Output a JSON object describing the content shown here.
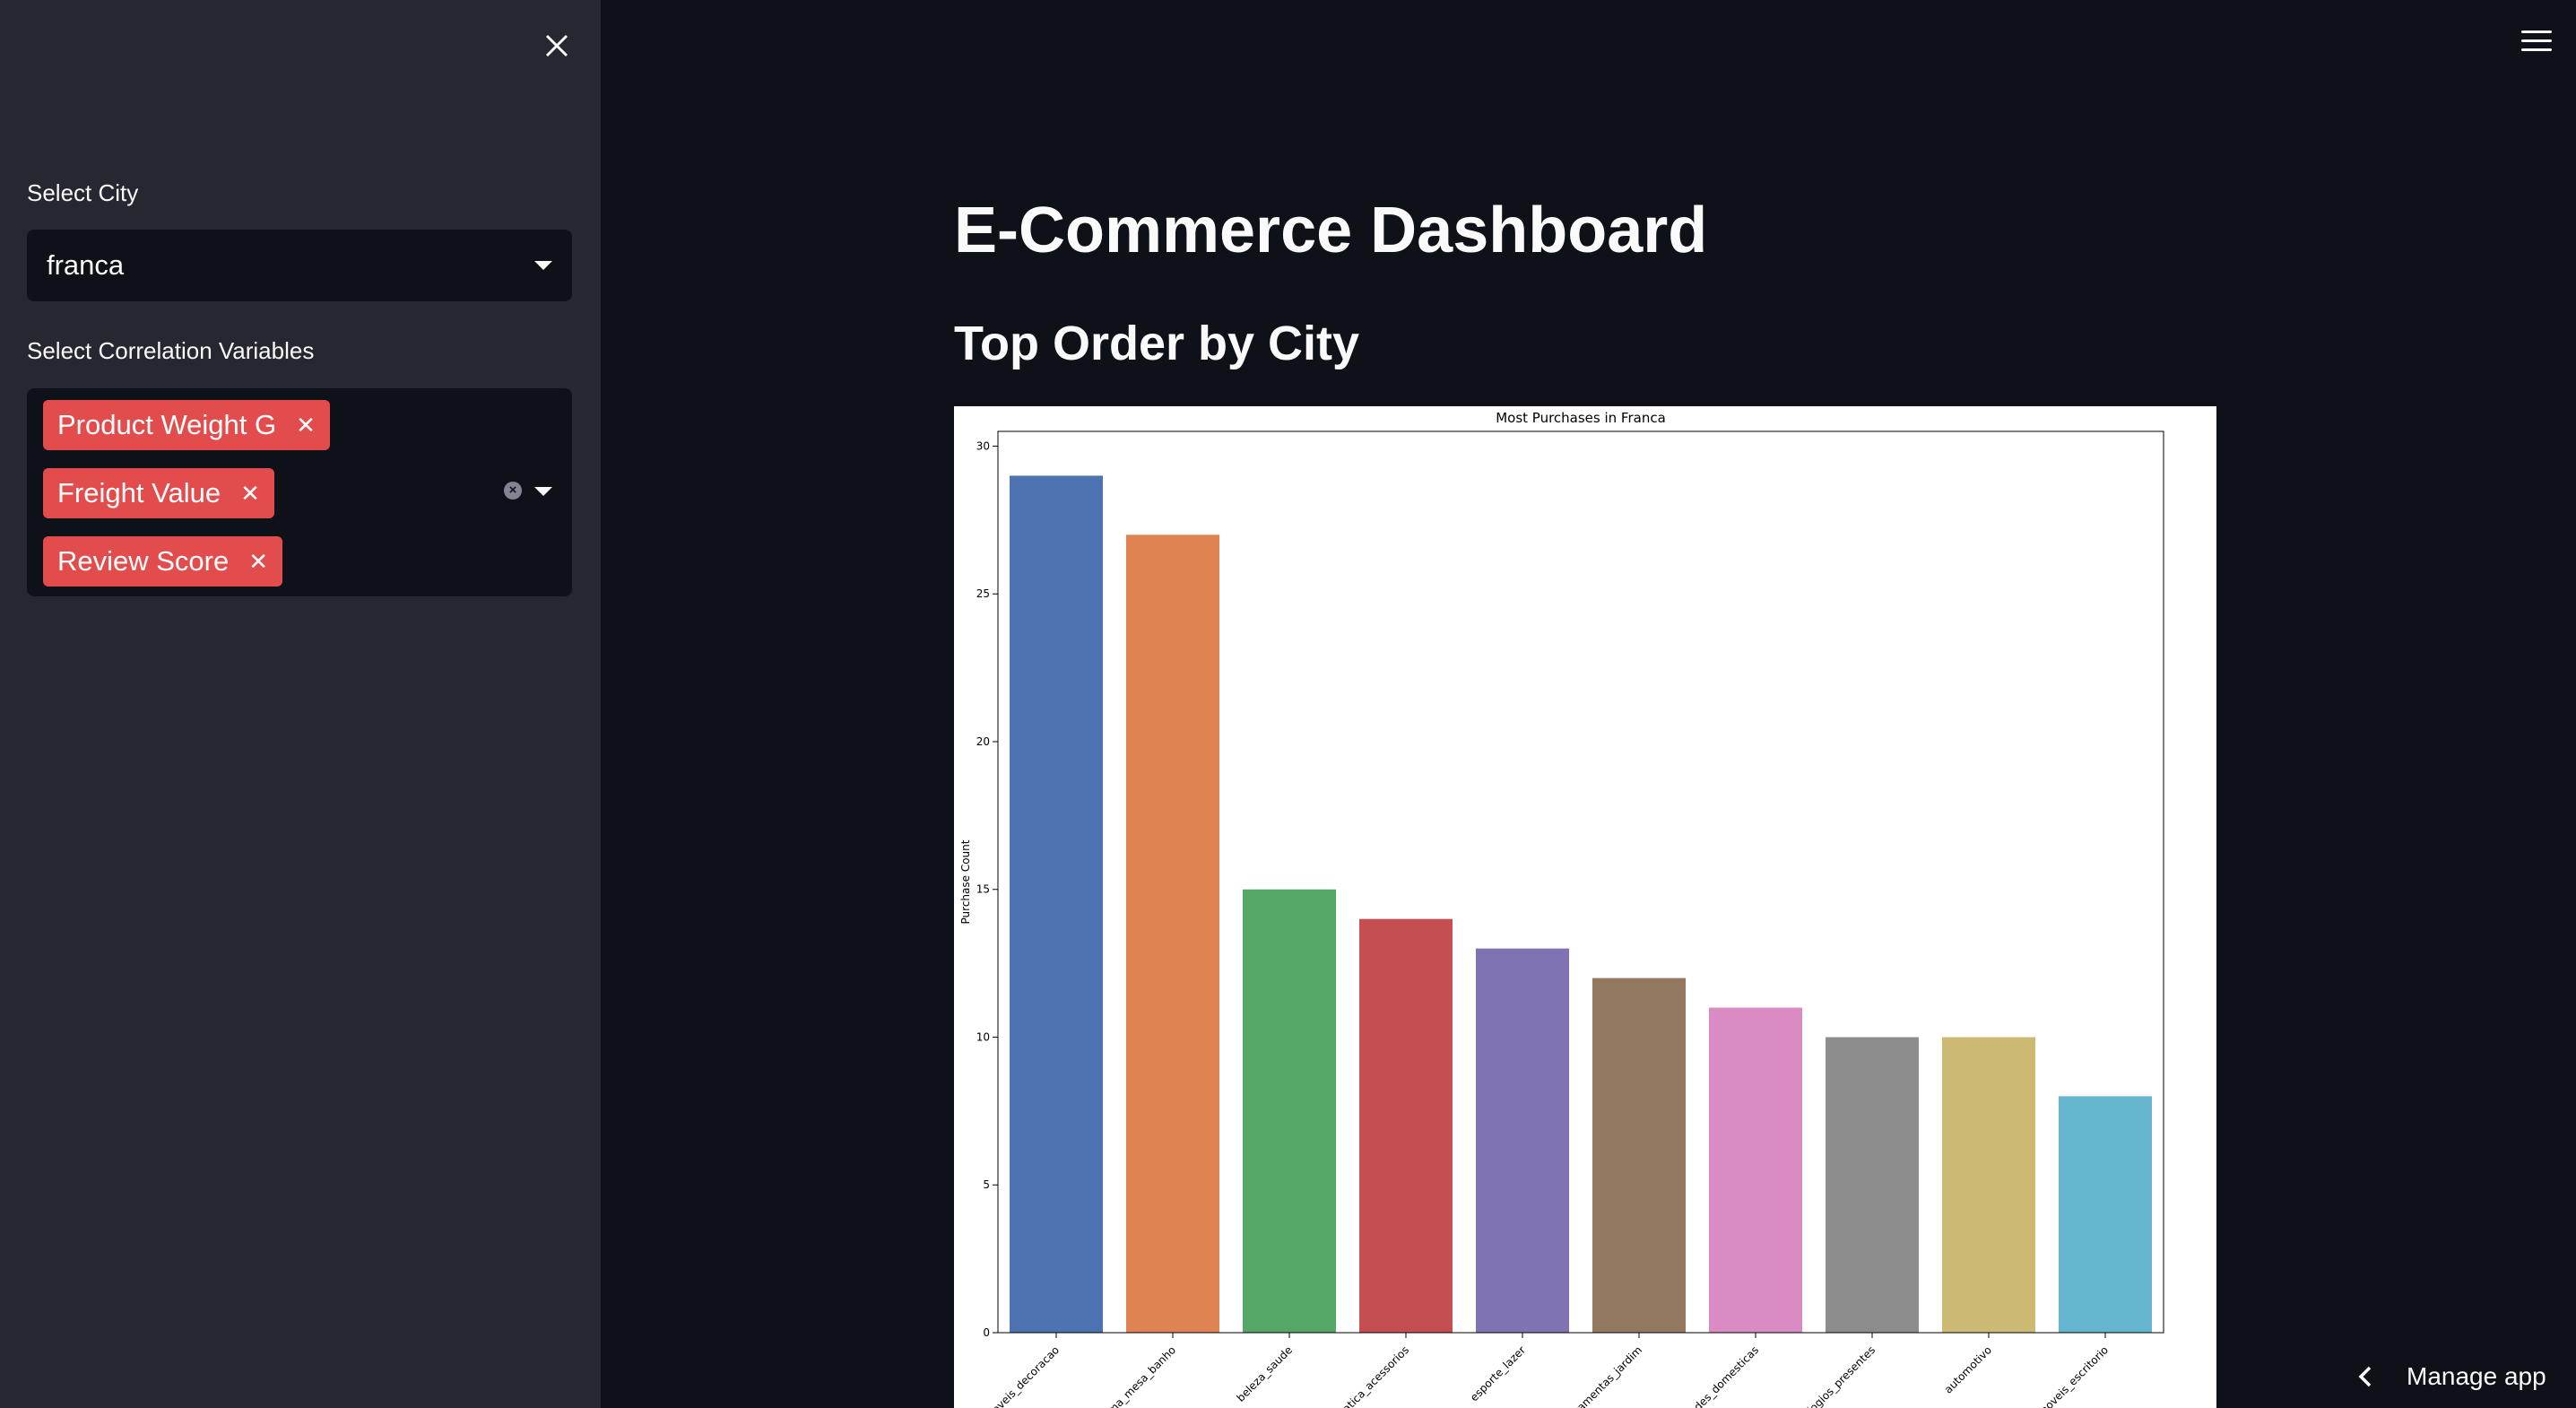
{
  "sidebar": {
    "city_label": "Select City",
    "city_value": "franca",
    "correlation_label": "Select Correlation Variables",
    "tags": [
      {
        "label": "Product Weight G"
      },
      {
        "label": "Freight Value"
      },
      {
        "label": "Review Score"
      }
    ]
  },
  "main": {
    "title": "E-Commerce Dashboard",
    "section_title": "Top Order by City"
  },
  "footer": {
    "manage_app": "Manage app"
  },
  "chart_data": {
    "type": "bar",
    "title": "Most Purchases in Franca",
    "xlabel": "",
    "ylabel": "Purchase Count",
    "ylim": [
      0,
      30.5
    ],
    "yticks": [
      0,
      5,
      10,
      15,
      20,
      25,
      30
    ],
    "categories": [
      "moveis_decoracao",
      "cama_mesa_banho",
      "beleza_saude",
      "informatica_acessorios",
      "esporte_lazer",
      "ferramentas_jardim",
      "utilidades_domesticas",
      "relogios_presentes",
      "automotivo",
      "moveis_escritorio"
    ],
    "values": [
      29,
      27,
      15,
      14,
      13,
      12,
      11,
      10,
      10,
      8
    ],
    "colors": [
      "#4c72b0",
      "#dd8452",
      "#55a868",
      "#c44e52",
      "#8172b3",
      "#937860",
      "#da8bc3",
      "#8c8c8c",
      "#ccb974",
      "#64b5cd"
    ]
  }
}
